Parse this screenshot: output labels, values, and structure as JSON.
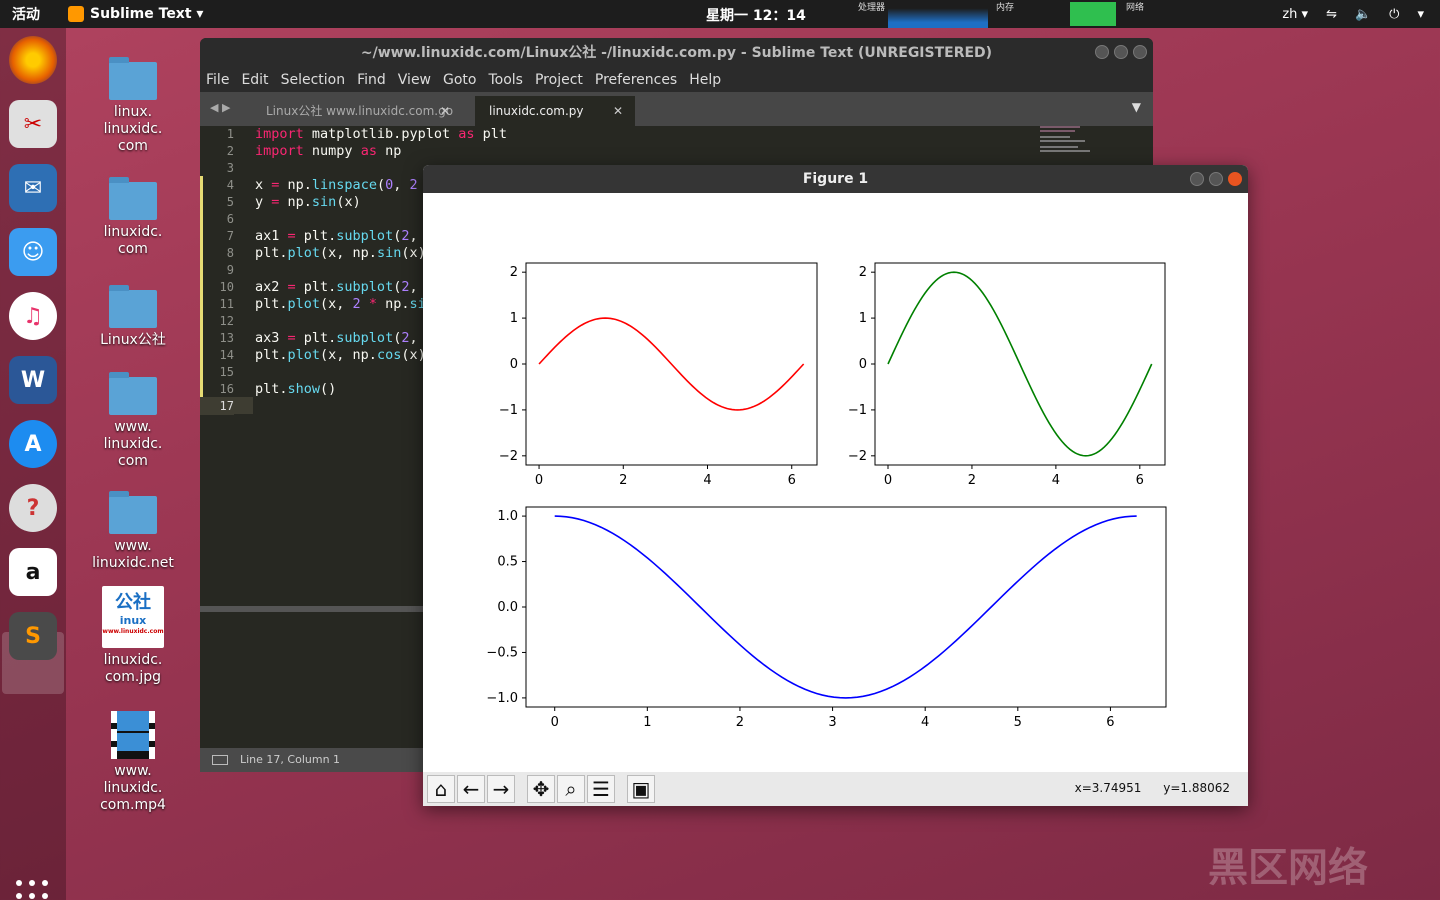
{
  "topbar": {
    "activities": "活动",
    "app_name": "Sublime Text ▾",
    "clock": "星期一 12：14",
    "monitor_cpu": "处理器",
    "monitor_mem": "内存",
    "monitor_net": "网络",
    "lang": "zh ▾"
  },
  "desktop": {
    "items": [
      {
        "label_lines": [
          "linux.",
          "linuxidc.",
          "com"
        ]
      },
      {
        "label_lines": [
          "linuxidc.",
          "com"
        ]
      },
      {
        "label_lines": [
          "Linux公社"
        ]
      },
      {
        "label_lines": [
          "www.",
          "linuxidc.",
          "com"
        ]
      },
      {
        "label_lines": [
          "www.",
          "linuxidc.net"
        ]
      },
      {
        "label_lines": [
          "linuxidc.",
          "com.jpg"
        ],
        "thumb_text": "公社",
        "thumb_sub": "inux",
        "thumb_url": "www.linuxidc.com"
      },
      {
        "label_lines": [
          "www.",
          "linuxidc.",
          "com.mp4"
        ]
      }
    ]
  },
  "sublime": {
    "title": "~/www.linuxidc.com/Linux公社 -/linuxidc.com.py - Sublime Text (UNREGISTERED)",
    "menu": [
      "File",
      "Edit",
      "Selection",
      "Find",
      "View",
      "Goto",
      "Tools",
      "Project",
      "Preferences",
      "Help"
    ],
    "tabs": [
      {
        "label": "Linux公社 www.linuxidc.com.go",
        "close": "✕"
      },
      {
        "label": "linuxidc.com.py",
        "close": "✕"
      }
    ],
    "line_numbers": [
      "1",
      "2",
      "3",
      "4",
      "5",
      "6",
      "7",
      "8",
      "9",
      "10",
      "11",
      "12",
      "13",
      "14",
      "15",
      "16",
      "17"
    ],
    "status": "Line 17, Column 1"
  },
  "figure": {
    "title": "Figure 1",
    "coords_x": "x=3.74951",
    "coords_y": "y=1.88062",
    "toolbar": [
      "home-icon",
      "back-arrow-icon",
      "forward-arrow-icon",
      "pan-icon",
      "zoom-icon",
      "subplots-icon",
      "save-icon"
    ]
  },
  "chart_data": [
    {
      "type": "line",
      "x_ticks": [
        "0",
        "2",
        "4",
        "6"
      ],
      "y_ticks": [
        "2",
        "1",
        "0",
        "−1",
        "−2"
      ],
      "xlim": [
        -0.31,
        6.6
      ],
      "ylim": [
        -2.2,
        2.2
      ],
      "series": [
        {
          "function": "sin(x)",
          "x_range": [
            0,
            6.2832
          ],
          "color": "#ff0000"
        }
      ]
    },
    {
      "type": "line",
      "x_ticks": [
        "0",
        "2",
        "4",
        "6"
      ],
      "y_ticks": [
        "2",
        "1",
        "0",
        "−1",
        "−2"
      ],
      "xlim": [
        -0.31,
        6.6
      ],
      "ylim": [
        -2.2,
        2.2
      ],
      "series": [
        {
          "function": "2*sin(x)",
          "x_range": [
            0,
            6.2832
          ],
          "color": "#008000"
        }
      ]
    },
    {
      "type": "line",
      "x_ticks": [
        "0",
        "1",
        "2",
        "3",
        "4",
        "5",
        "6"
      ],
      "y_ticks": [
        "1.0",
        "0.5",
        "0.0",
        "−0.5",
        "−1.0"
      ],
      "xlim": [
        -0.31,
        6.6
      ],
      "ylim": [
        -1.1,
        1.1
      ],
      "series": [
        {
          "function": "cos(x)",
          "x_range": [
            0,
            6.2832
          ],
          "color": "#0000ff"
        }
      ]
    }
  ],
  "watermark": "黑区网络"
}
